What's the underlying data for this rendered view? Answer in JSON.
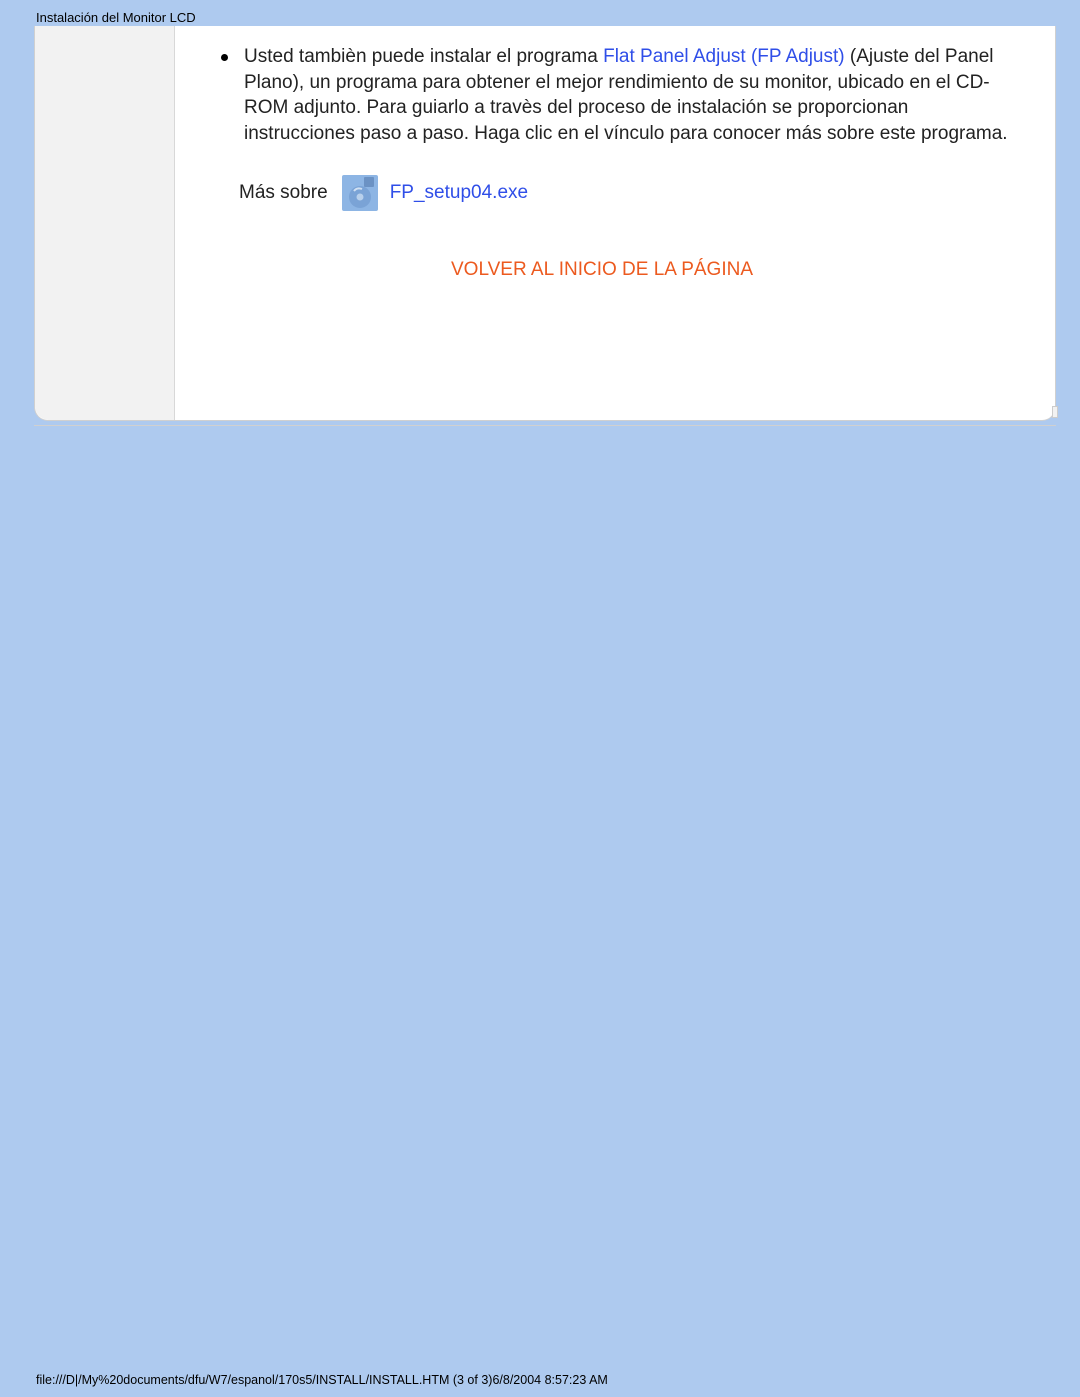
{
  "header": {
    "title": "Instalación del Monitor LCD"
  },
  "content": {
    "paragraph": {
      "prefix": "Usted tambièn puede instalar el programa ",
      "link_text": "Flat Panel Adjust (FP Adjust)",
      "suffix": " (Ajuste del Panel Plano), un programa para obtener el mejor rendimiento de su monitor, ubicado en el CD-ROM adjunto. Para guiarlo a travès del proceso de instalación se proporcionan instrucciones paso a paso. Haga clic en el vínculo para conocer más sobre este programa."
    },
    "more_about_label": "Más sobre",
    "file_link": "FP_setup04.exe",
    "back_to_top": "VOLVER AL INICIO DE LA PÁGINA"
  },
  "footer": {
    "path": "file:///D|/My%20documents/dfu/W7/espanol/170s5/INSTALL/INSTALL.HTM (3 of 3)6/8/2004 8:57:23 AM"
  }
}
